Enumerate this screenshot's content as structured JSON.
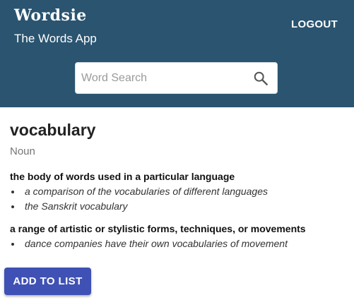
{
  "header": {
    "brand": "Wordsie",
    "subtitle": "The Words App",
    "logout_label": "LOGOUT",
    "background_color": "#2a5470"
  },
  "search": {
    "placeholder": "Word Search",
    "value": "",
    "icon": "search-icon"
  },
  "entry": {
    "word": "vocabulary",
    "part_of_speech": "Noun",
    "senses": [
      {
        "definition": "the body of words used in a particular language",
        "examples": [
          "a comparison of the vocabularies of different languages",
          "the Sanskrit vocabulary"
        ]
      },
      {
        "definition": "a range of artistic or stylistic forms, techniques, or movements",
        "examples": [
          "dance companies have their own vocabularies of movement"
        ]
      }
    ]
  },
  "actions": {
    "add_to_list_label": "ADD TO LIST",
    "button_color": "#3f51b5"
  }
}
